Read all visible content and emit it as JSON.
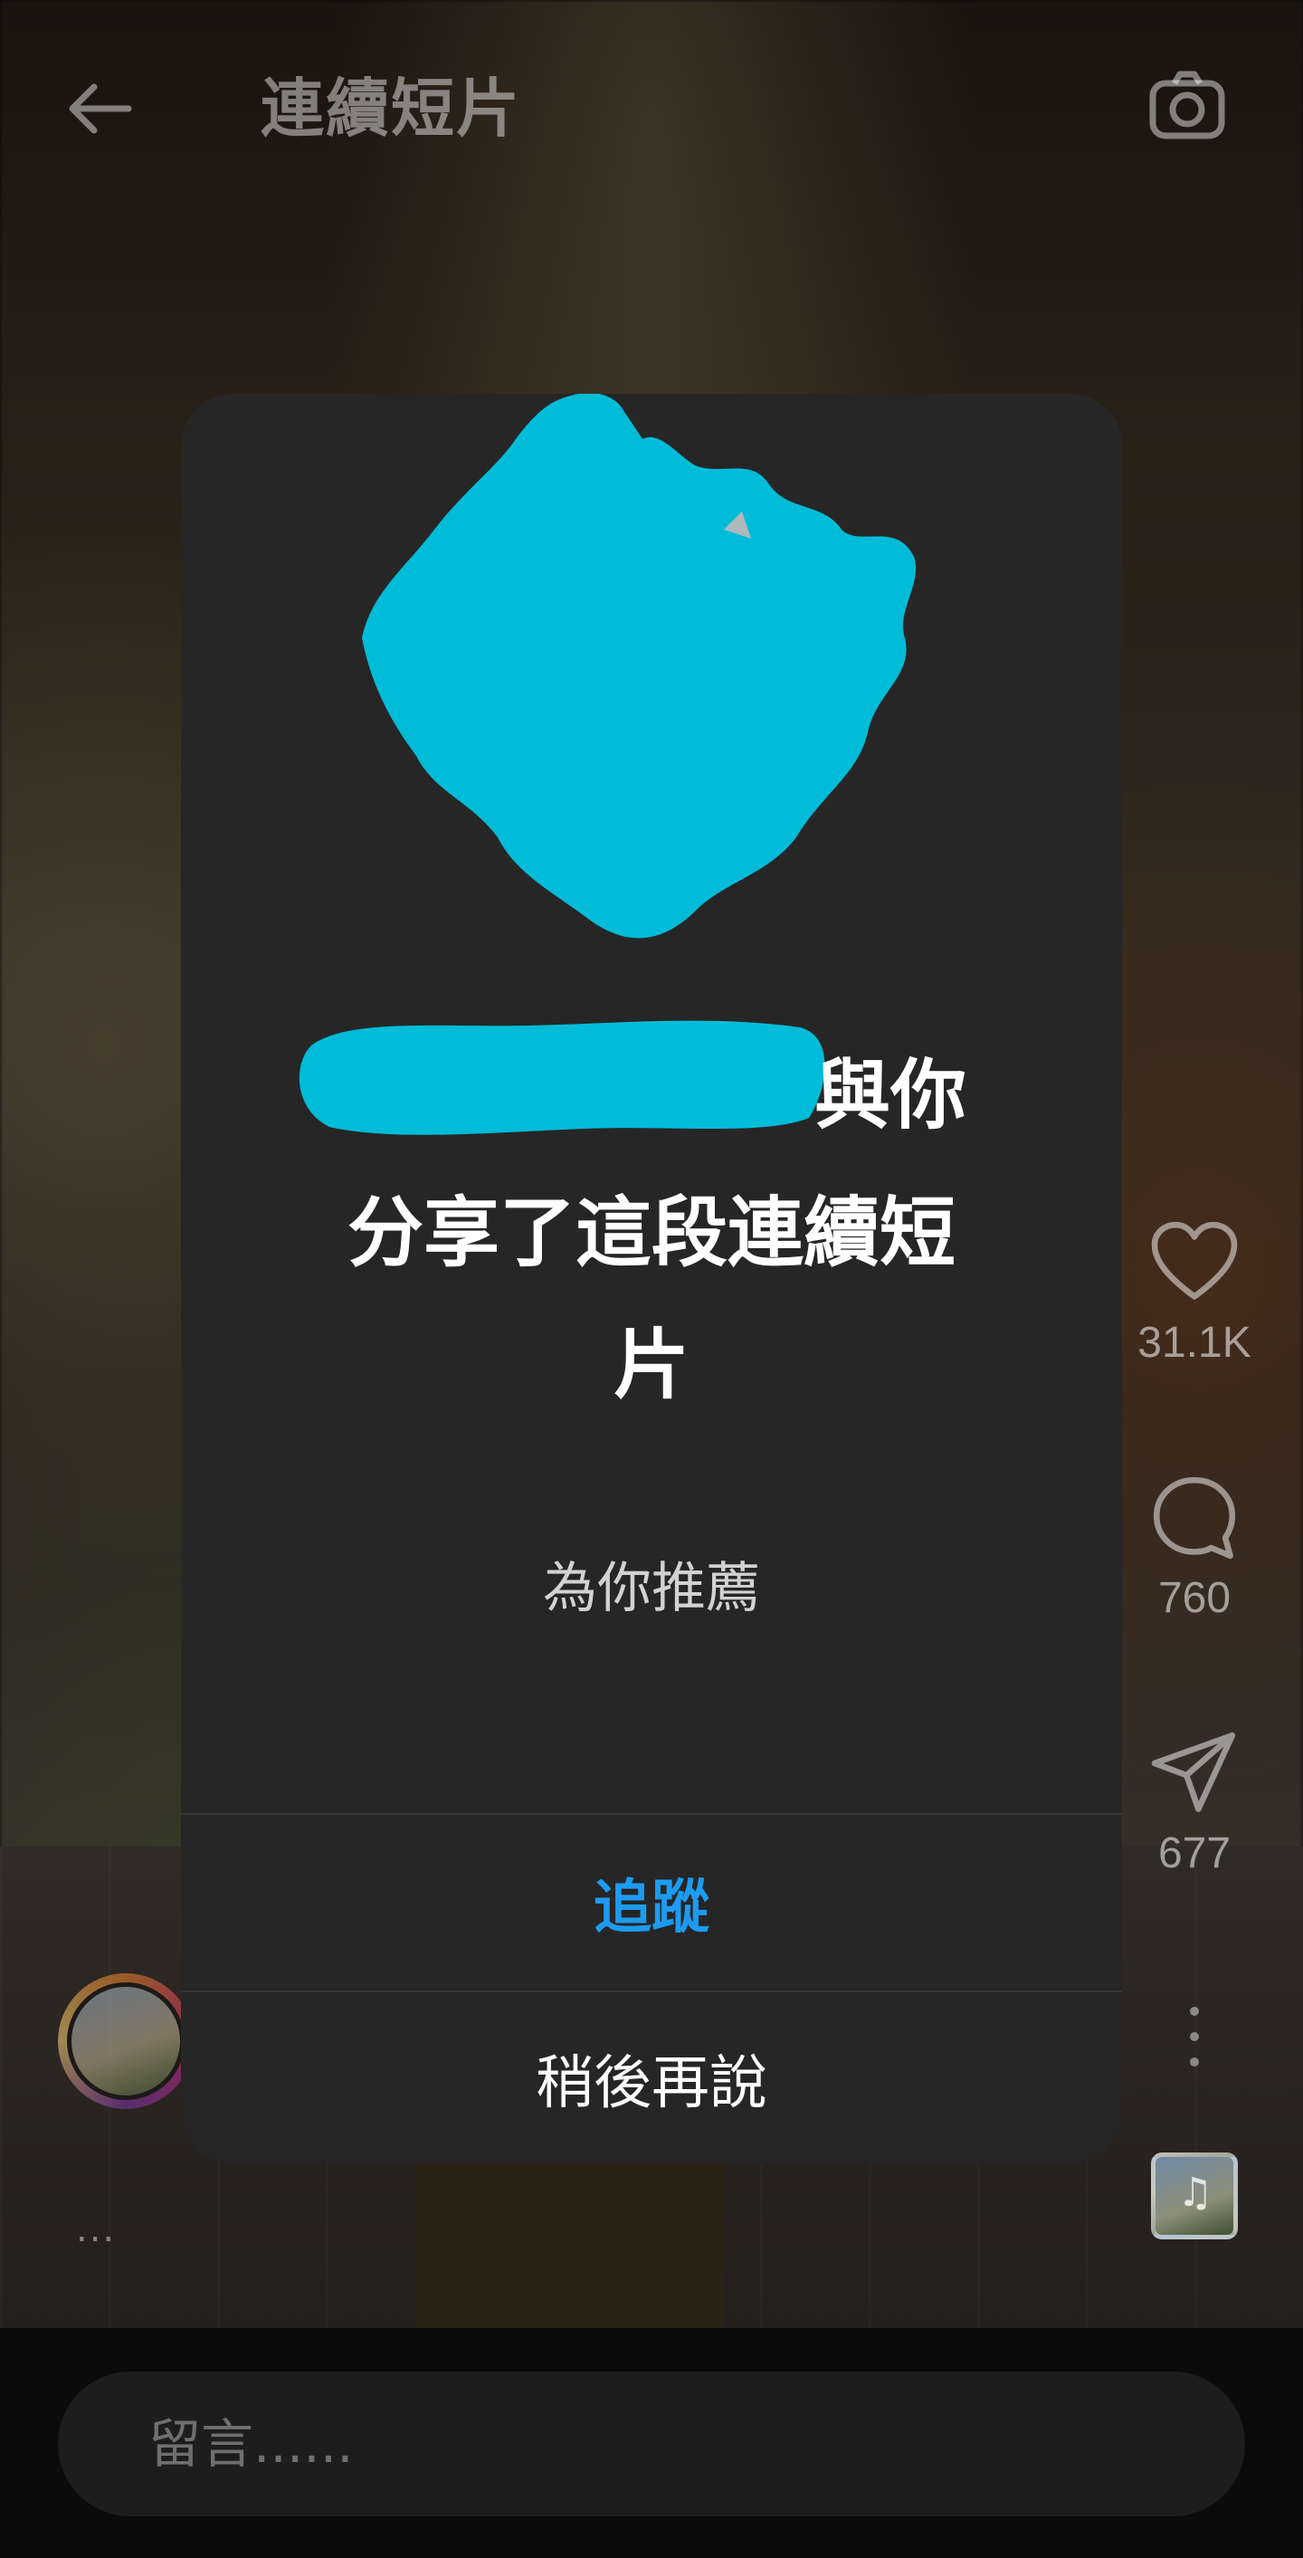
{
  "top_bar": {
    "title": "連續短片",
    "back_icon": "arrow-left-icon",
    "camera_icon": "camera-icon"
  },
  "actions": {
    "like_count": "31.1K",
    "comment_count": "760",
    "share_count": "677",
    "like_icon": "heart-icon",
    "comment_icon": "comment-bubble-icon",
    "share_icon": "paper-plane-icon",
    "more_icon": "vertical-dots-icon",
    "audio_icon": "music-note-icon"
  },
  "caption": {
    "more": "..."
  },
  "modal": {
    "message_line_1": "與你",
    "message_line_2": "分享了這段連續短",
    "message_line_3": "片",
    "recommend_label": "為你推薦",
    "follow_button": "追蹤",
    "later_button": "稍後再說"
  },
  "comment_bar": {
    "placeholder": "留言......"
  },
  "colors": {
    "modal_bg": "#262626",
    "follow_blue": "#1d9bf0",
    "redaction_cyan": "#00bcd8"
  }
}
